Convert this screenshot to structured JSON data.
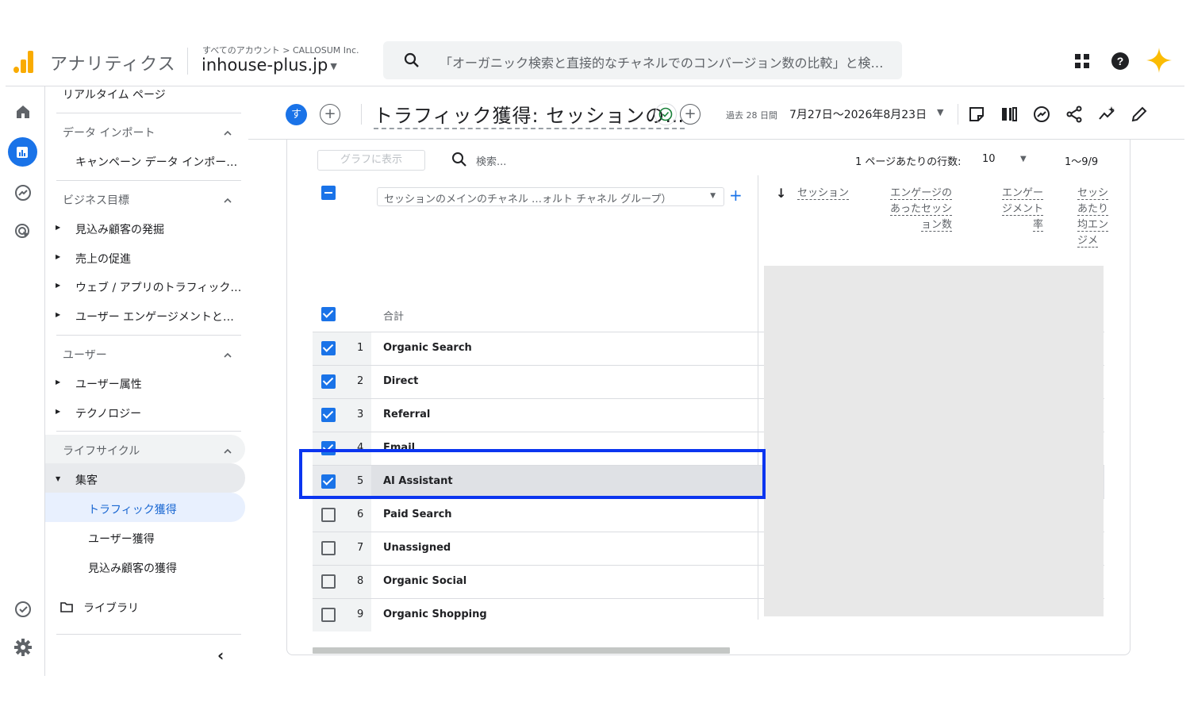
{
  "header": {
    "app_name": "アナリティクス",
    "account_path": "すべてのアカウント > CALLOSUM Inc.",
    "property": "inhouse-plus.jp",
    "search_placeholder": "「オーガニック検索と直接的なチャネルでのコンバージョン数の比較」と検…",
    "icons": [
      "apps-grid-icon",
      "help-icon",
      "gemini-sparkle-icon"
    ]
  },
  "rail": {
    "icons": [
      "home-icon",
      "reports-icon",
      "explore-icon",
      "advertising-icon",
      "admin-check-icon",
      "settings-gear-icon"
    ],
    "active": "reports-icon"
  },
  "nav": {
    "realtime": "リアルタイム ページ",
    "data_import_section": "データ インポート",
    "campaign_import": "キャンペーン データ インポー…",
    "business_section": "ビジネス目標",
    "business_items": [
      "見込み顧客の発掘",
      "売上の促進",
      "ウェブ / アプリのトラフィック…",
      "ユーザー エンゲージメントと…"
    ],
    "user_section": "ユーザー",
    "user_items": [
      "ユーザー属性",
      "テクノロジー"
    ],
    "lifecycle_section": "ライフサイクル",
    "acquisition": "集客",
    "acquisition_items": [
      "トラフィック獲得",
      "ユーザー獲得",
      "見込み顧客の獲得"
    ],
    "library": "ライブラリ",
    "collapse": "‹"
  },
  "report": {
    "avatar_letter": "す",
    "title": "トラフィック獲得: セッションの…",
    "date_label": "過去 28 日間",
    "date_range": "7月27日～2026年8月23日"
  },
  "table": {
    "chart_button": "グラフに表示",
    "search_placeholder": "検索...",
    "rows_per_page_label": "1 ページあたりの行数:",
    "rows_per_page": "10",
    "pager": "1～9/9",
    "dimension": "セッションのメインのチャネル …ォルト チャネル グループ）",
    "metrics": [
      {
        "lines": [
          "セッション"
        ]
      },
      {
        "lines": [
          "エンゲージの",
          "あったセッシ",
          "ョン数"
        ]
      },
      {
        "lines": [
          "エンゲー",
          "ジメント",
          "率"
        ]
      },
      {
        "lines": [
          "セッシ",
          "あたり",
          "均エン",
          "ジメ"
        ]
      }
    ],
    "total_label": "合計",
    "rows": [
      {
        "num": "1",
        "label": "Organic Search",
        "checked": true
      },
      {
        "num": "2",
        "label": "Direct",
        "checked": true
      },
      {
        "num": "3",
        "label": "Referral",
        "checked": true
      },
      {
        "num": "4",
        "label": "Email",
        "checked": true
      },
      {
        "num": "5",
        "label": "AI Assistant",
        "checked": true
      },
      {
        "num": "6",
        "label": "Paid Search",
        "checked": false
      },
      {
        "num": "7",
        "label": "Unassigned",
        "checked": false
      },
      {
        "num": "8",
        "label": "Organic Social",
        "checked": false
      },
      {
        "num": "9",
        "label": "Organic Shopping",
        "checked": false
      }
    ],
    "highlighted_row": "AI Assistant"
  },
  "colors": {
    "accent": "#1a73e8",
    "logo": "#f9ab00",
    "highlight": "#0b35f0"
  }
}
